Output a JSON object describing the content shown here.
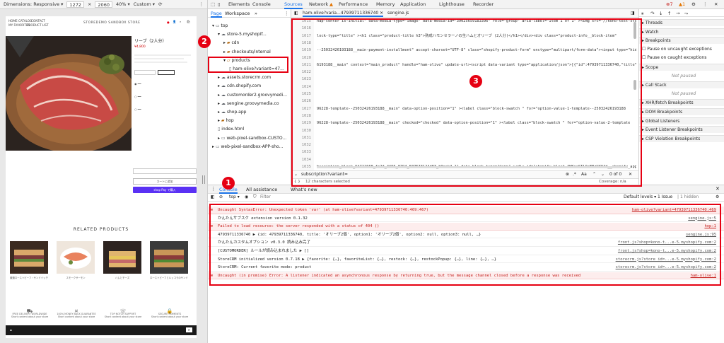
{
  "device_toolbar": {
    "dimensions_label": "Dimensions: Responsive",
    "width": "1272",
    "height": "2060",
    "zoom": "40%",
    "throttle": "Custom"
  },
  "site": {
    "nav_left": [
      "HOME",
      "CATALOG",
      "CONTACT",
      "MY FAVORITES",
      "PRODUCT LIST"
    ],
    "brand": "STOREDEMO SANDBOX STORE",
    "product_title": "リーブ（2人分）",
    "price": "¥4,800",
    "add_to_cart": "カートに追加",
    "shop_pay": "shop Pay で購入",
    "related_title": "RELATED PRODUCTS",
    "related_items": [
      "厳選ローストビーフ・サンドイッチ",
      "スモークサーモン",
      "ハムとチーズ",
      "ローストビーフとルッコラのサンド"
    ],
    "features": [
      "FREE DELIVERY WORLDWIDE",
      "100% MONEY BACK GUARANTEE",
      "TOP NOTCH SUPPORT",
      "SECURE PAYMENTS"
    ],
    "feature_sub": "Short content about your store"
  },
  "devtools": {
    "tabs": [
      "Elements",
      "Console",
      "Sources",
      "Network",
      "Performance",
      "Memory",
      "Application",
      "Lighthouse",
      "Recorder"
    ],
    "active_tab": "Sources",
    "error_count": "7",
    "warn_count": "1",
    "sources_subtabs": [
      "Page",
      "Workspace"
    ],
    "file_tree": [
      {
        "label": "top",
        "indent": 0,
        "icon": "frame"
      },
      {
        "label": "store-5.myshopif...",
        "indent": 1,
        "icon": "cloud"
      },
      {
        "label": "cdn",
        "indent": 2,
        "icon": "folder"
      },
      {
        "label": "checkouts/internal",
        "indent": 2,
        "icon": "folder"
      },
      {
        "label": "products",
        "indent": 2,
        "icon": "folder-open"
      },
      {
        "label": "ham-olive?variant=47...",
        "indent": 3,
        "icon": "file"
      },
      {
        "label": "assets.storecrm.com",
        "indent": 1,
        "icon": "cloud"
      },
      {
        "label": "cdn.shopify.com",
        "indent": 1,
        "icon": "cloud"
      },
      {
        "label": "customorder2.groovymedi...",
        "indent": 1,
        "icon": "cloud"
      },
      {
        "label": "sengine.groovymedia.co",
        "indent": 1,
        "icon": "cloud"
      },
      {
        "label": "shop.app",
        "indent": 1,
        "icon": "cloud"
      },
      {
        "label": "hop",
        "indent": 1,
        "icon": "folder"
      },
      {
        "label": "index.html",
        "indent": 1,
        "icon": "file"
      },
      {
        "label": "web-pixel-sandbox-CUSTO...",
        "indent": 1,
        "icon": "frame"
      },
      {
        "label": "web-pixel-sandbox-APP-sho...",
        "indent": 0,
        "icon": "frame"
      }
    ],
    "editor_tabs": [
      "ham-olive?varia...47939711336740",
      "sengine.js"
    ],
    "line_numbers": [
      "1015",
      "1016",
      "1017",
      "1018",
      "1019",
      "1020",
      "1021",
      "1022",
      "1023",
      "1024",
      "1025",
      "1026",
      "1027",
      "1028",
      "1029",
      "1030",
      "1031",
      "1032",
      "1033",
      "1034",
      "1035"
    ],
    "code_lines": [
      "nap-center is-initial\" data-media-type=\"image\" data-media-id=\"39025659183396\" role=\"group\" aria-label=\"Item 1 of 1\" ><img src=\"//kono-test-sto",
      "",
      "lock-type=\"title\" ><h1 class=\"product-title h3\">熟成ハモンセラーノの生ハムとオリーブ (2人分)</h1></div><div class=\"product-info__block-item\"",
      "",
      "--25032426193188__main-payment-installment\" accept-charset=\"UTF-8\" class=\"shopify-product-form\" enctype=\"multipart/form-data\"><input type=\"hid",
      "",
      "6193188__main\" context=\"main_product\" handle=\"ham-olive\" update-url><script data-variant type=\"application/json\">[{\"id\":47939711336740,\"title\":",
      "",
      "",
      "",
      "",
      "",
      "96228-template--25032426193188__main\"     data-option-position=\"1\" ><label class=\"block-swatch  \" for=\"option-value-1-template--25032426193188",
      "",
      "96228-template--25032426193188__main\" checked=\"checked\"   data-option-position=\"1\" ><label class=\"block-swatch  \" for=\"option-value-2-template",
      "",
      "",
      "",
      "",
      "",
      "bscription_block_5f721660_fc2f_4f56_8794_507573124d83_b9ock4-1\" data-block-type=\"@app\" ><div id=\"shopify-block-AWKrcSTlQaFNzUYV4d__shopify_app"
    ],
    "find_query": "subscription?variant=",
    "find_count": "0 of 0",
    "status_selected": "12 characters selected",
    "status_coverage": "Coverage: n/a",
    "debugger_sections": [
      {
        "label": "Threads",
        "section": true
      },
      {
        "label": "Watch",
        "section": true
      },
      {
        "label": "Breakpoints",
        "section": true
      },
      {
        "label": "Pause on uncaught exceptions",
        "section": false,
        "checkbox": true
      },
      {
        "label": "Pause on caught exceptions",
        "section": false,
        "checkbox": true
      },
      {
        "label": "Scope",
        "section": true
      },
      {
        "label": "Not paused",
        "section": false,
        "italic": true
      },
      {
        "label": "Call Stack",
        "section": true
      },
      {
        "label": "Not paused",
        "section": false,
        "italic": true
      },
      {
        "label": "XHR/fetch Breakpoints",
        "section": true
      },
      {
        "label": "DOM Breakpoints",
        "section": true
      },
      {
        "label": "Global Listeners",
        "section": true
      },
      {
        "label": "Event Listener Breakpoints",
        "section": true
      },
      {
        "label": "CSP Violation Breakpoints",
        "section": true
      }
    ],
    "console_tabs": [
      "Console",
      "All assistance",
      "What's new"
    ],
    "console_context": "top",
    "console_filter": "Filter",
    "default_levels": "Default levels",
    "issues": "1 Issue",
    "hidden": "1 hidden",
    "messages": [
      {
        "type": "err",
        "text": "Uncaught SyntaxError: Unexpected token 'var' (at ham-olive?variant=47939711336740:469:467)",
        "src": "ham-olive?variant=47939711336740:469"
      },
      {
        "type": "log",
        "text": "かんたんサブスク extension version 0.1.32",
        "src": "sengine.js:5"
      },
      {
        "type": "err",
        "text": "Failed to load resource: the server responded with a status of 404 ()",
        "src": "hop:1"
      },
      {
        "type": "log",
        "text": "47939711336740  ▶ {id: 47939711336740, title: 'オリーブ2個', option1: 'オリーブ2個', option2: null, option3: null, …}",
        "src": "sengine.js:95"
      },
      {
        "type": "log",
        "text": "かんたんカスタムオプション v0.3.0 読み込み完了",
        "src": "front.js?shop=kono-t...e-5.myshopify.com:2"
      },
      {
        "type": "log",
        "text": "[CUSTOMORDER] ルールが読み込まれました  ▶ []",
        "src": "front.js?shop=kono-t...e-5.myshopify.com:2"
      },
      {
        "type": "log",
        "text": "StoreCRM initialized version 0.7.18  ▶ {favorite: {…}, favoriteList: {…}, restock: {…}, restockPopup: {…}, line: {…}, …}",
        "src": "storecrm.js?store_id=...e-5.myshopify.com:2"
      },
      {
        "type": "log",
        "text": "StoreCRM: Current favorite mode:  product",
        "src": "storecrm.js?store_id=...e-5.myshopify.com:2"
      },
      {
        "type": "err",
        "text": "Uncaught (in promise) Error: A listener indicated an asynchronous response by returning true, but the message channel closed before a response was received",
        "src": "ham-olive:1"
      }
    ]
  },
  "annotations": {
    "badge1": "1",
    "badge2": "2",
    "badge3": "3",
    "highlight_color": "#e60012"
  }
}
